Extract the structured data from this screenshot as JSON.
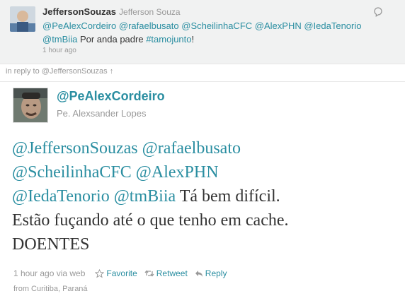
{
  "parent_tweet": {
    "screen_name": "JeffersonSouzas",
    "display_name": "Jefferson Souza",
    "mentions_line1": [
      "@PeAlexCordeiro",
      "@rafaelbusato",
      "@ScheilinhaCFC",
      "@AlexPHN",
      "@IedaTenorio"
    ],
    "mention_line2": "@tmBiia",
    "text_plain": " Por anda padre ",
    "hashtag": "#tamojunto",
    "text_end": "!",
    "time": "1 hour ago"
  },
  "in_reply": {
    "prefix": "in reply to",
    "user": "@JeffersonSouzas",
    "arrow": "↑"
  },
  "main_tweet": {
    "screen_name": "@PeAlexCordeiro",
    "display_name": "Pe. Alexsander Lopes",
    "mentions": [
      "@JeffersonSouzas",
      "@rafaelbusato",
      "@ScheilinhaCFC",
      "@AlexPHN",
      "@IedaTenorio",
      "@tmBiia"
    ],
    "text_line3_end": " Tá bem difícil.",
    "text_line4": "Estão fuçando até o que tenho em cache.",
    "text_line5": "DOENTES",
    "time": "1 hour ago via web",
    "actions": {
      "favorite": "Favorite",
      "retweet": "Retweet",
      "reply": "Reply"
    },
    "location": "from Curitiba, Paraná"
  },
  "colors": {
    "link": "#2a8ea1",
    "muted": "#999999",
    "text": "#333333",
    "parent_bg": "#f1f2f2"
  }
}
